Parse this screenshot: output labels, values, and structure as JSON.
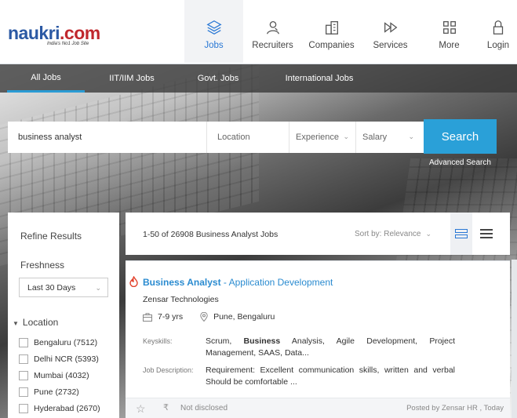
{
  "brand": {
    "logo_first": "naukri",
    "logo_second": ".com",
    "tagline": "India's No1 Job Site"
  },
  "nav": [
    {
      "label": "Jobs",
      "icon": "jobs-stack-icon",
      "active": true
    },
    {
      "label": "Recruiters",
      "icon": "recruiter-person-icon"
    },
    {
      "label": "Companies",
      "icon": "building-icon"
    },
    {
      "label": "Services",
      "icon": "play-forward-icon"
    },
    {
      "label": "More",
      "icon": "grid-icon"
    },
    {
      "label": "Login",
      "icon": "lock-icon"
    }
  ],
  "tabs": [
    {
      "label": "All Jobs",
      "active": true
    },
    {
      "label": "IIT/IIM Jobs"
    },
    {
      "label": "Govt. Jobs"
    },
    {
      "label": "International Jobs"
    }
  ],
  "search": {
    "keyword_value": "business analyst",
    "location_placeholder": "Location",
    "experience_placeholder": "Experience",
    "salary_placeholder": "Salary",
    "button": "Search",
    "advanced": "Advanced Search"
  },
  "refine": {
    "title": "Refine Results",
    "freshness_title": "Freshness",
    "freshness_value": "Last 30 Days",
    "location_title": "Location",
    "locations": [
      {
        "label": "Bengaluru (7512)"
      },
      {
        "label": "Delhi NCR (5393)"
      },
      {
        "label": "Mumbai (4032)"
      },
      {
        "label": "Pune (2732)"
      },
      {
        "label": "Hyderabad (2670)"
      }
    ]
  },
  "results": {
    "count_text": "1-50 of 26908 Business Analyst Jobs",
    "sort_text": "Sort by: Relevance"
  },
  "job": {
    "title_bold": "Business Analyst",
    "title_rest": " - Application Development",
    "company": "Zensar Technologies",
    "experience": "7-9 yrs",
    "location": "Pune, Bengaluru",
    "keyskills_label": "Keyskills:",
    "keyskills_pre": "Scrum, ",
    "keyskills_bold": "Business",
    "keyskills_post": " Analysis, Agile Development, Project Management, SAAS, Data...",
    "jd_label": "Job Description:",
    "jd_text": "Requirement: Excellent communication skills, written and verbal Should be comfortable ...",
    "salary": "Not disclosed",
    "posted": "Posted by Zensar HR , Today"
  },
  "colors": {
    "brand_blue": "#2b59a4",
    "brand_red": "#c0272d",
    "accent": "#2aa0d8",
    "link": "#2a8bd0"
  }
}
